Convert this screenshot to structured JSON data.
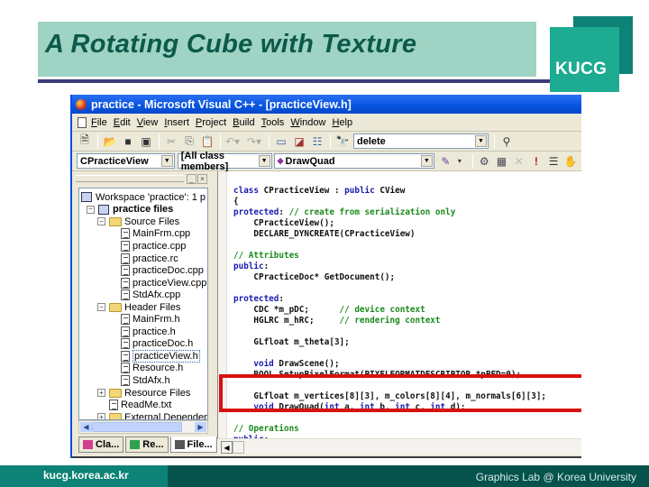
{
  "slide": {
    "title": "A Rotating Cube with Texture",
    "logo_text": "KUCG",
    "footer_url": "kucg.korea.ac.kr",
    "footer_lab": "Graphics Lab @ Korea University",
    "colors": {
      "title_band": "#9fd3c3",
      "title_text": "#0b5a4a",
      "rule": "#3c3b7a",
      "logo_front": "#1dab92",
      "logo_back": "#0d8276",
      "footer_left": "#0d8276",
      "footer_right": "#06524c",
      "highlight": "#d81010"
    }
  },
  "window": {
    "title": "practice - Microsoft Visual C++ - [practiceView.h]",
    "menu": [
      {
        "label": "File",
        "accel": "F"
      },
      {
        "label": "Edit",
        "accel": "E"
      },
      {
        "label": "View",
        "accel": "V"
      },
      {
        "label": "Insert",
        "accel": "I"
      },
      {
        "label": "Project",
        "accel": "P"
      },
      {
        "label": "Build",
        "accel": "B"
      },
      {
        "label": "Tools",
        "accel": "T"
      },
      {
        "label": "Window",
        "accel": "W"
      },
      {
        "label": "Help",
        "accel": "H"
      }
    ],
    "toolbar1": {
      "icons": [
        "new-text-file-icon",
        "open-folder-icon",
        "save-icon",
        "save-all-icon",
        "cut-icon",
        "copy-icon",
        "paste-icon",
        "undo-icon",
        "redo-icon",
        "workspace-icon",
        "output-icon",
        "window-list-icon",
        "find-in-files-icon"
      ],
      "find_combo_value": "delete",
      "find_icon": "binoculars-icon"
    },
    "toolbar2": {
      "class_combo": "CPracticeView",
      "filter_combo": "[All class members]",
      "members_combo": "DrawQuad",
      "right_icons": [
        "wizard-action-icon",
        "compile-icon",
        "build-icon",
        "stop-build-icon",
        "execute-icon",
        "insert-breakpoint-icon",
        "go-hand-icon"
      ]
    },
    "workspace": {
      "tree": [
        {
          "label": "Workspace 'practice': 1 p",
          "type": "workspace",
          "depth": 0
        },
        {
          "label": "practice files",
          "type": "project",
          "depth": 1,
          "expander": "−",
          "bold": true
        },
        {
          "label": "Source Files",
          "type": "folder",
          "depth": 2,
          "expander": "−"
        },
        {
          "label": "MainFrm.cpp",
          "type": "file",
          "depth": 3
        },
        {
          "label": "practice.cpp",
          "type": "file",
          "depth": 3
        },
        {
          "label": "practice.rc",
          "type": "file",
          "depth": 3
        },
        {
          "label": "practiceDoc.cpp",
          "type": "file",
          "depth": 3
        },
        {
          "label": "practiceView.cpp",
          "type": "file",
          "depth": 3
        },
        {
          "label": "StdAfx.cpp",
          "type": "file",
          "depth": 3
        },
        {
          "label": "Header Files",
          "type": "folder",
          "depth": 2,
          "expander": "−"
        },
        {
          "label": "MainFrm.h",
          "type": "file",
          "depth": 3
        },
        {
          "label": "practice.h",
          "type": "file",
          "depth": 3
        },
        {
          "label": "practiceDoc.h",
          "type": "file",
          "depth": 3
        },
        {
          "label": "practiceView.h",
          "type": "file",
          "depth": 3,
          "selected": true
        },
        {
          "label": "Resource.h",
          "type": "file",
          "depth": 3
        },
        {
          "label": "StdAfx.h",
          "type": "file",
          "depth": 3
        },
        {
          "label": "Resource Files",
          "type": "folder",
          "depth": 2,
          "expander": "+"
        },
        {
          "label": "ReadMe.txt",
          "type": "file",
          "depth": 2
        },
        {
          "label": "External Dependen",
          "type": "folder",
          "depth": 2,
          "expander": "+"
        }
      ],
      "tabs": [
        {
          "label": "Cla...",
          "icon": "classview-icon"
        },
        {
          "label": "Re...",
          "icon": "resourceview-icon"
        },
        {
          "label": "File...",
          "icon": "fileview-icon",
          "active": true
        }
      ]
    },
    "editor": {
      "lines": [
        [
          {
            "t": "class",
            "c": "kw"
          },
          {
            "t": " CPracticeView : "
          },
          {
            "t": "public",
            "c": "kw"
          },
          {
            "t": " CView"
          }
        ],
        [
          {
            "t": "{"
          }
        ],
        [
          {
            "t": "protected",
            "c": "kw"
          },
          {
            "t": ": "
          },
          {
            "t": "// create from serialization only",
            "c": "cm"
          }
        ],
        [
          {
            "t": "    CPracticeView();"
          }
        ],
        [
          {
            "t": "    DECLARE_DYNCREATE(CPracticeView)"
          }
        ],
        [
          {
            "t": ""
          }
        ],
        [
          {
            "t": "// Attributes",
            "c": "cm"
          }
        ],
        [
          {
            "t": "public",
            "c": "kw"
          },
          {
            "t": ":"
          }
        ],
        [
          {
            "t": "    CPracticeDoc* GetDocument();"
          }
        ],
        [
          {
            "t": ""
          }
        ],
        [
          {
            "t": "protected",
            "c": "kw"
          },
          {
            "t": ":"
          }
        ],
        [
          {
            "t": "    CDC *m_pDC;      "
          },
          {
            "t": "// device context",
            "c": "cm"
          }
        ],
        [
          {
            "t": "    HGLRC m_hRC;     "
          },
          {
            "t": "// rendering context",
            "c": "cm"
          }
        ],
        [
          {
            "t": ""
          }
        ],
        [
          {
            "t": "    GLfloat m_theta[3];"
          }
        ],
        [
          {
            "t": ""
          }
        ],
        [
          {
            "t": "    "
          },
          {
            "t": "void",
            "c": "kw"
          },
          {
            "t": " DrawScene();"
          }
        ],
        [
          {
            "t": "    BOOL SetupPixelFormat(PIXELFORMATDESCRIPTOR *pPFD=0);"
          }
        ],
        [
          {
            "t": ""
          }
        ],
        [
          {
            "t": "    GLfloat m_vertices[8][3], m_colors[8][4], m_normals[6][3];"
          }
        ],
        [
          {
            "t": "    "
          },
          {
            "t": "void",
            "c": "kw"
          },
          {
            "t": " DrawQuad("
          },
          {
            "t": "int",
            "c": "kw"
          },
          {
            "t": " a, "
          },
          {
            "t": "int",
            "c": "kw"
          },
          {
            "t": " b, "
          },
          {
            "t": "int",
            "c": "kw"
          },
          {
            "t": " c, "
          },
          {
            "t": "int",
            "c": "kw"
          },
          {
            "t": " d);"
          }
        ],
        [
          {
            "t": ""
          }
        ],
        [
          {
            "t": "// Operations",
            "c": "cm"
          }
        ],
        [
          {
            "t": "public",
            "c": "kw"
          },
          {
            "t": ":"
          }
        ]
      ],
      "highlighted_lines": [
        19,
        20
      ]
    }
  }
}
